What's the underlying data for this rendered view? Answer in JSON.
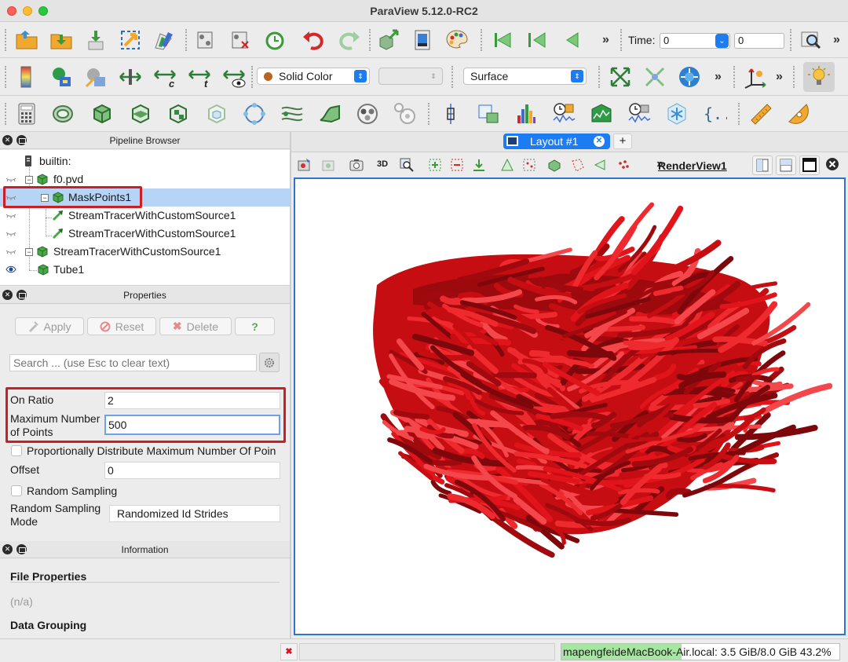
{
  "window": {
    "title": "ParaView 5.12.0-RC2"
  },
  "time": {
    "label": "Time:",
    "value": "0",
    "index": "0"
  },
  "representation": {
    "coloring": "Solid Color",
    "component": "",
    "type": "Surface"
  },
  "pipeline": {
    "title": "Pipeline Browser",
    "items": [
      {
        "label": "builtin:"
      },
      {
        "label": "f0.pvd"
      },
      {
        "label": "MaskPoints1"
      },
      {
        "label": "StreamTracerWithCustomSource1"
      },
      {
        "label": "StreamTracerWithCustomSource1"
      },
      {
        "label": "StreamTracerWithCustomSource1"
      },
      {
        "label": "Tube1"
      }
    ]
  },
  "properties": {
    "title": "Properties",
    "apply": "Apply",
    "reset": "Reset",
    "delete": "Delete",
    "help": "?",
    "search_placeholder": "Search ... (use Esc to clear text)",
    "on_ratio_label": "On Ratio",
    "on_ratio": "2",
    "max_points_label_1": "Maximum Number",
    "max_points_label_2": "of Points",
    "max_points": "500",
    "proportional": "Proportionally Distribute Maximum Number Of Poin",
    "offset_label": "Offset",
    "offset": "0",
    "random_sampling": "Random Sampling",
    "random_mode_label_1": "Random Sampling",
    "random_mode_label_2": "Mode",
    "random_mode": "Randomized Id Strides"
  },
  "information": {
    "title": "Information",
    "file_properties": "File Properties",
    "na": "(n/a)",
    "data_grouping": "Data Grouping"
  },
  "layout": {
    "tab": "Layout #1",
    "add": "+",
    "view_name": "RenderView1",
    "mode_3d": "3D"
  },
  "status": {
    "memory": "mapengfeideMacBook-Air.local: 3.5 GiB/8.0 GiB 43.2%",
    "memory_fraction": 0.432
  },
  "colors": {
    "accent": "#1d7cf2",
    "highlight": "#cc1f24",
    "streamlines": "#e0141a"
  }
}
